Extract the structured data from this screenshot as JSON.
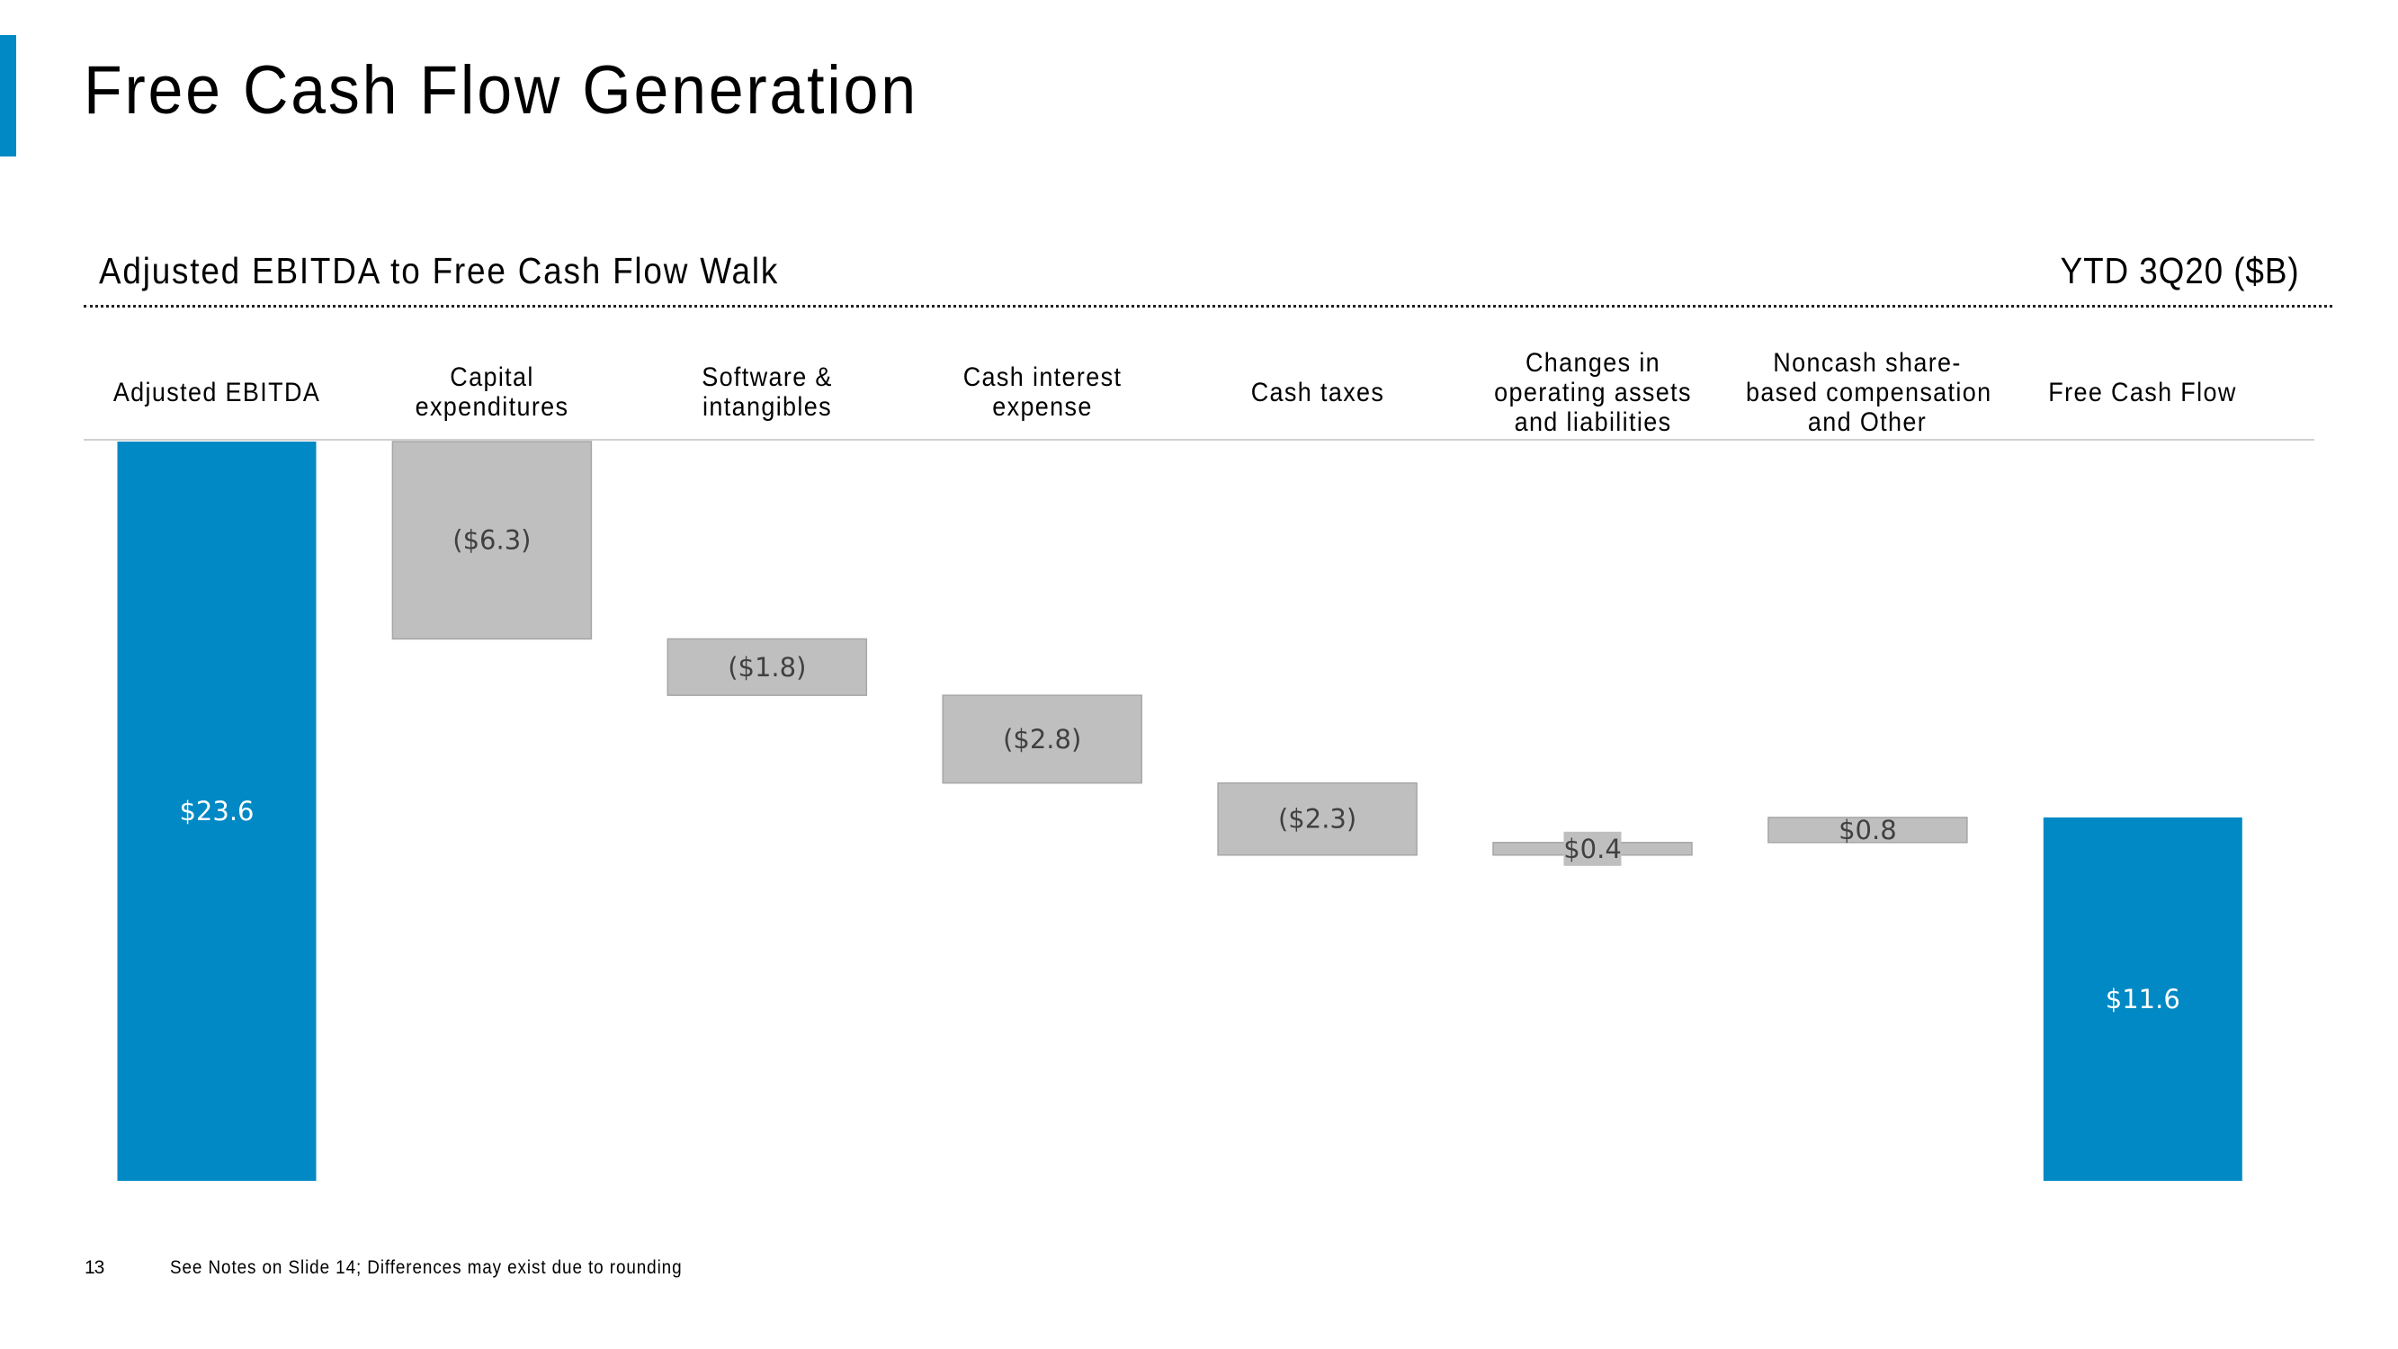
{
  "slide": {
    "title": "Free Cash Flow Generation",
    "subtitle": "Adjusted EBITDA to Free Cash Flow Walk",
    "period": "YTD 3Q20 ($B)",
    "page_number": "13",
    "footnote": "See Notes on Slide 14; Differences may exist due to rounding"
  },
  "colors": {
    "accent": "#0089c4",
    "total_bar": "#0089c4",
    "step_bar": "#bfbfbf",
    "step_bar_edge": "#a6a6a6",
    "total_label": "#ffffff",
    "step_label": "#404040"
  },
  "chart_data": {
    "type": "bar",
    "subtype": "waterfall",
    "title": "Adjusted EBITDA to Free Cash Flow Walk",
    "unit": "$B",
    "categories": [
      [
        "Adjusted EBITDA"
      ],
      [
        "Capital",
        "expenditures"
      ],
      [
        "Software &",
        "intangibles"
      ],
      [
        "Cash interest",
        "expense"
      ],
      [
        "Cash taxes"
      ],
      [
        "Changes in",
        "operating assets",
        "and liabilities"
      ],
      [
        "Noncash share-",
        "based compensation",
        "and Other"
      ],
      [
        "Free Cash Flow"
      ]
    ],
    "values": [
      23.6,
      -6.3,
      -1.8,
      -2.8,
      -2.3,
      0.4,
      0.8,
      11.6
    ],
    "kinds": [
      "total",
      "step",
      "step",
      "step",
      "step",
      "step",
      "step",
      "total"
    ],
    "labels": [
      "$23.6",
      "($6.3)",
      "($1.8)",
      "($2.8)",
      "($2.3)",
      "$0.4",
      "$0.8",
      "$11.6"
    ],
    "ylim": [
      0,
      23.6
    ],
    "grid": false,
    "legend": "none"
  }
}
